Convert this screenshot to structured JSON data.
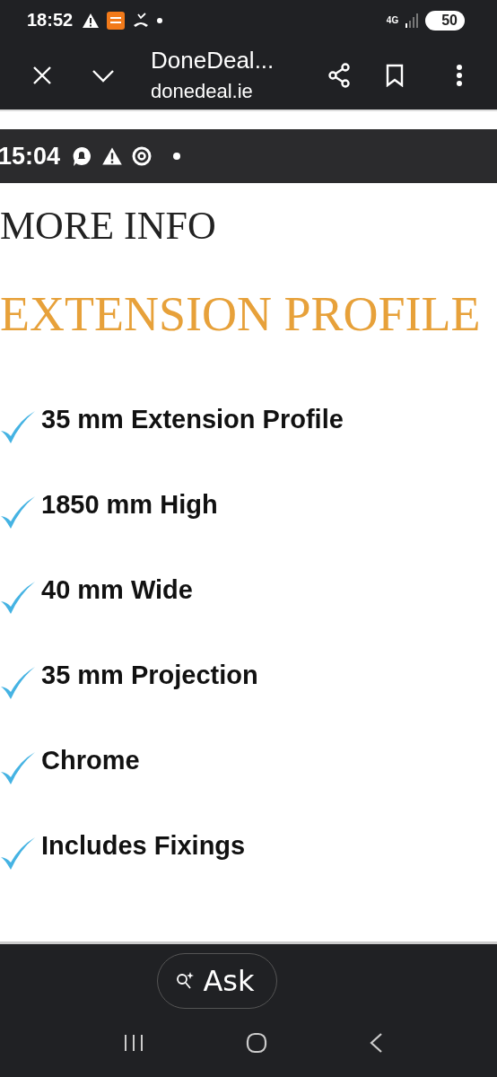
{
  "status_bar": {
    "time": "18:52",
    "network": "4G",
    "battery": "50"
  },
  "browser_toolbar": {
    "title": "DoneDeal...",
    "url": "donedeal.ie"
  },
  "image": {
    "status_bar": {
      "time": "15:04"
    },
    "heading": "MORE INFO",
    "subheading": "EXTENSION PROFILE",
    "features": [
      "35 mm Extension Profile",
      "1850 mm High",
      "40 mm Wide",
      "35 mm Projection",
      "Chrome",
      "Includes Fixings"
    ]
  },
  "ask_button": {
    "label": "Ask"
  }
}
